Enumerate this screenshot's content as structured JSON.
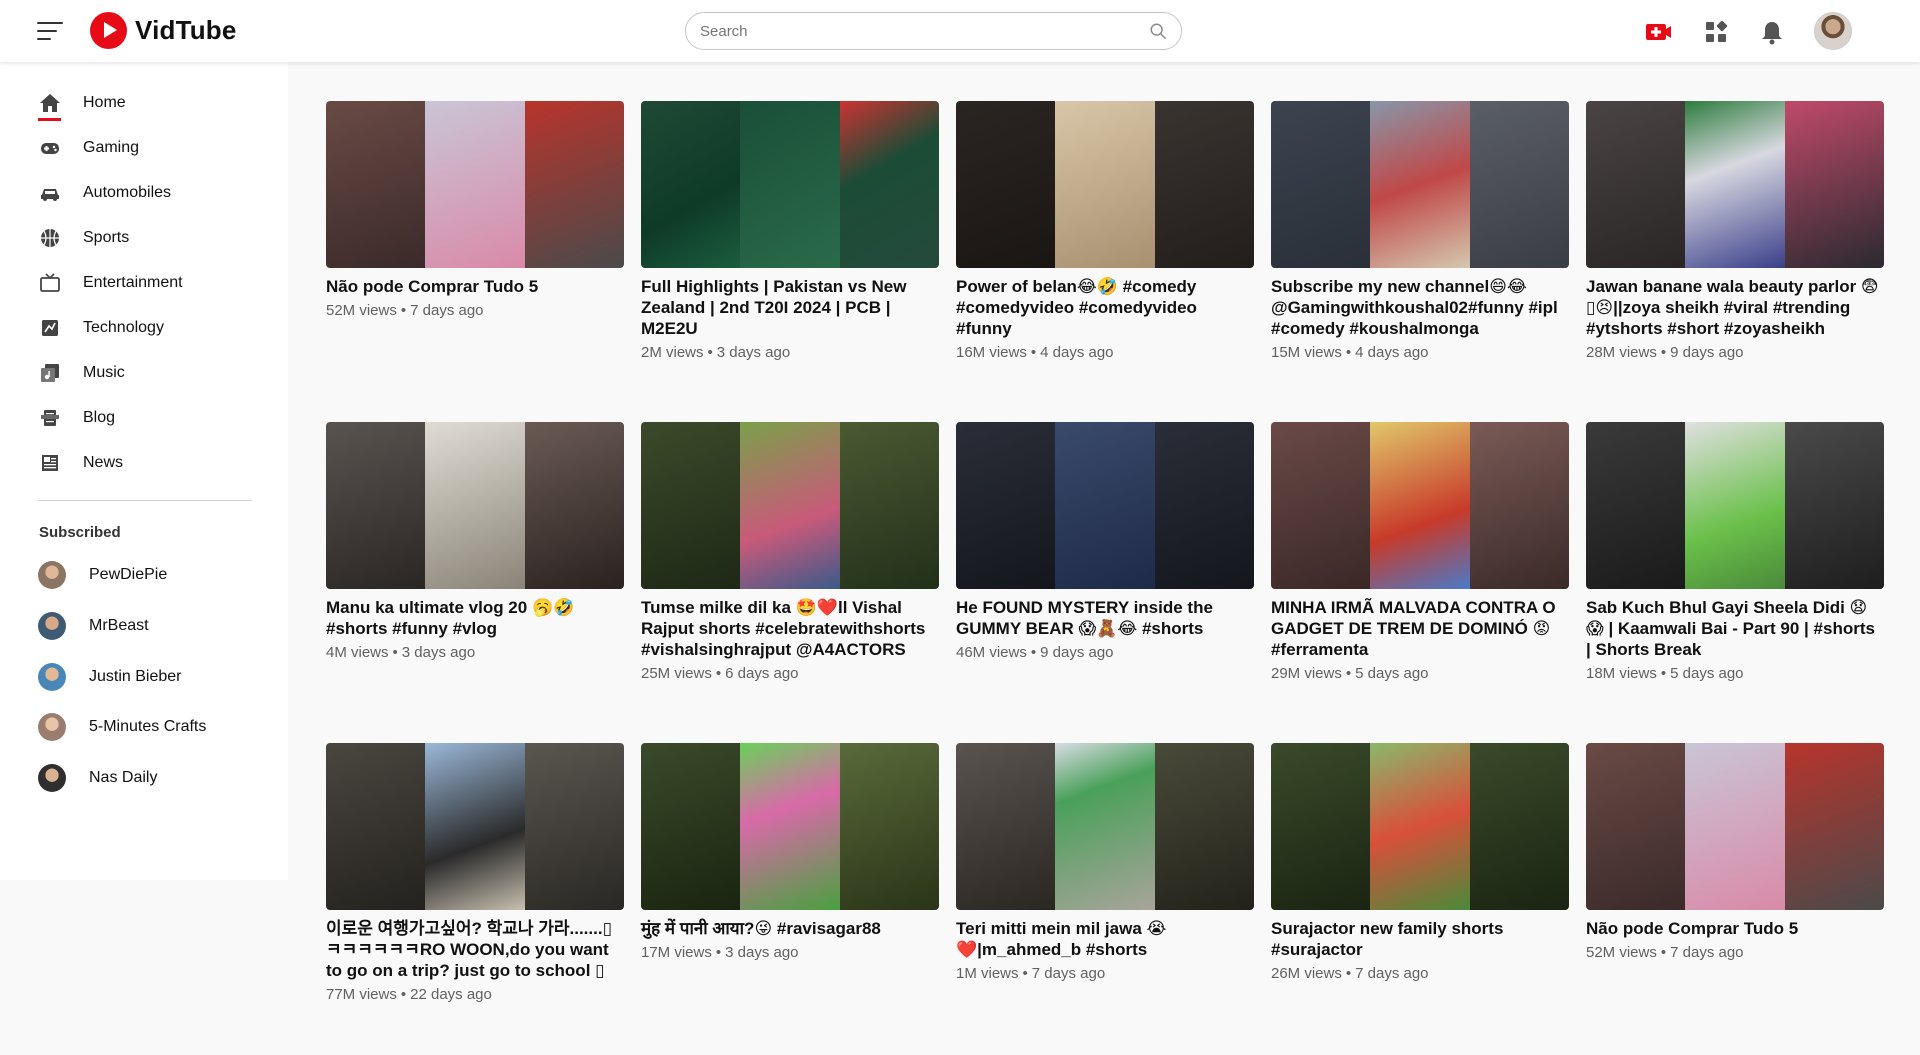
{
  "app": {
    "name": "VidTube"
  },
  "header": {
    "search_placeholder": "Search",
    "icons": [
      "menu-icon",
      "search-icon",
      "video-create-icon",
      "apps-grid-icon",
      "bell-icon",
      "user-avatar"
    ]
  },
  "colors": {
    "brand_red": "#e60b17",
    "meta_gray": "#606060"
  },
  "sidebar": {
    "nav": [
      {
        "label": "Home",
        "icon": "home-icon",
        "active": true
      },
      {
        "label": "Gaming",
        "icon": "gamepad-icon"
      },
      {
        "label": "Automobiles",
        "icon": "car-icon"
      },
      {
        "label": "Sports",
        "icon": "ball-icon"
      },
      {
        "label": "Entertainment",
        "icon": "tv-icon"
      },
      {
        "label": "Technology",
        "icon": "chip-icon"
      },
      {
        "label": "Music",
        "icon": "music-icon"
      },
      {
        "label": "Blog",
        "icon": "blog-icon"
      },
      {
        "label": "News",
        "icon": "newspaper-icon"
      }
    ],
    "subscribed_title": "Subscribed",
    "subscribed": [
      {
        "label": "PewDiePie"
      },
      {
        "label": "MrBeast"
      },
      {
        "label": "Justin Bieber"
      },
      {
        "label": "5-Minutes Crafts"
      },
      {
        "label": "Nas Daily"
      }
    ]
  },
  "videos": [
    {
      "title": "Não pode Comprar Tudo 5",
      "views": "52M views",
      "age": "7 days ago"
    },
    {
      "title": "Full Highlights | Pakistan vs New Zealand | 2nd T20I 2024 | PCB | M2E2U",
      "views": "2M views",
      "age": "3 days ago"
    },
    {
      "title": "Power of belan😂🤣 #comedy #comedyvideo #comedyvideo #funny",
      "views": "16M views",
      "age": "4 days ago"
    },
    {
      "title": "Subscribe my new channel😄😂 @Gamingwithkoushal02#funny #ipl #comedy #koushalmonga",
      "views": "15M views",
      "age": "4 days ago"
    },
    {
      "title": "Jawan banane wala beauty parlor 😨▯😣||zoya sheikh #viral #trending #ytshorts #short #zoyasheikh",
      "views": "28M views",
      "age": "9 days ago"
    },
    {
      "title": "Manu ka ultimate vlog 20 🥱🤣 #shorts #funny #vlog",
      "views": "4M views",
      "age": "3 days ago"
    },
    {
      "title": "Tumse milke dil ka 🤩❤️ll Vishal Rajput shorts #celebratewithshorts #vishalsinghrajput @A4ACTORS",
      "views": "25M views",
      "age": "6 days ago"
    },
    {
      "title": "He FOUND MYSTERY inside the GUMMY BEAR 😱🧸😂 #shorts",
      "views": "46M views",
      "age": "9 days ago"
    },
    {
      "title": "MINHA IRMÃ MALVADA CONTRA O GADGET DE TREM DE DOMINÓ 😡 #ferramenta",
      "views": "29M views",
      "age": "5 days ago"
    },
    {
      "title": "Sab Kuch Bhul Gayi Sheela Didi 😧😱 | Kaamwali Bai - Part 90 | #shorts | Shorts Break",
      "views": "18M views",
      "age": "5 days ago"
    },
    {
      "title": "이로운 여행가고싶어? 학교나 가라.......▯ ㅋㅋㅋㅋㅋㅋRO WOON,do you want to go on a trip? just go to school ▯",
      "views": "77M views",
      "age": "22 days ago"
    },
    {
      "title": "मुंह में पानी आया?😜 #ravisagar88",
      "views": "17M views",
      "age": "3 days ago"
    },
    {
      "title": "Teri mitti mein mil jawa 😭 ❤️|m_ahmed_b #shorts",
      "views": "1M views",
      "age": "7 days ago"
    },
    {
      "title": "Surajactor new family shorts #surajactor",
      "views": "26M views",
      "age": "7 days ago"
    },
    {
      "title": "Não pode Comprar Tudo 5",
      "views": "52M views",
      "age": "7 days ago"
    }
  ]
}
